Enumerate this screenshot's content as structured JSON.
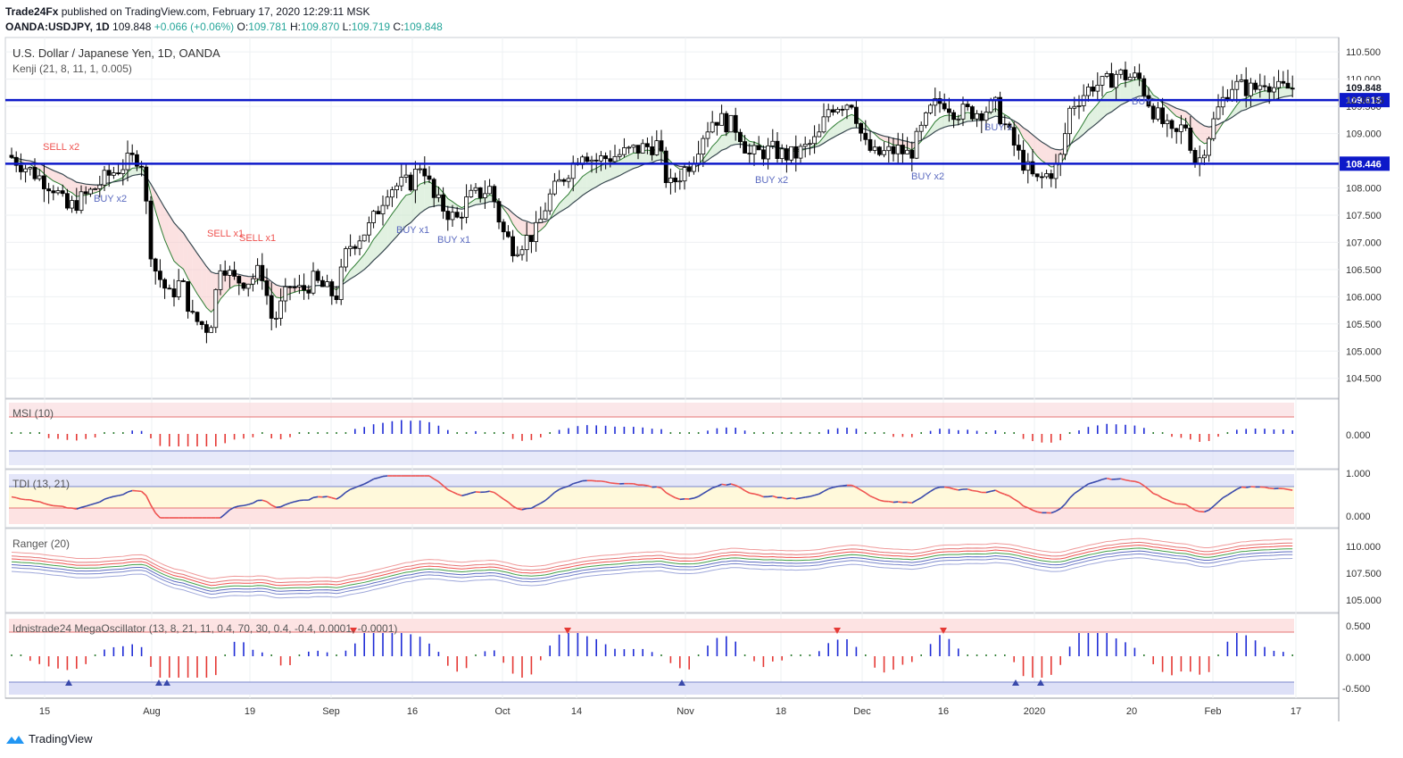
{
  "header": {
    "publisher": "Trade24Fx",
    "published_text": "published on TradingView.com, February 17, 2020 12:29:11 MSK",
    "symbol": "OANDA:USDJPY, 1D",
    "last": "109.848",
    "change": "+0.066 (+0.06%)",
    "o_label": "O:",
    "o": "109.781",
    "h_label": "H:",
    "h": "109.870",
    "l_label": "L:",
    "l": "109.719",
    "c_label": "C:",
    "c": "109.848"
  },
  "main_pane": {
    "title": "U.S. Dollar / Japanese Yen, 1D, OANDA",
    "indicator": "Kenji (21, 8, 11, 1, 0.005)",
    "price_labels": {
      "last": "109.848",
      "time": "12:30:56",
      "upper_line": "109.615",
      "lower_line": "108.446"
    }
  },
  "panes": {
    "msi": {
      "label": "MSI (10)",
      "ticks": [
        "0.000"
      ]
    },
    "tdi": {
      "label": "TDI (13, 21)",
      "ticks": [
        "1.000",
        "0.000"
      ]
    },
    "ranger": {
      "label": "Ranger (20)",
      "ticks": [
        "110.000",
        "107.500",
        "105.000"
      ]
    },
    "mega": {
      "label": "Idnistrade24 MegaOscillator (13, 8, 21, 11, 0.4, 70, 30, 0.4, -0.4, 0.0001, -0.0001)",
      "ticks": [
        "0.500",
        "0.000",
        "-0.500"
      ]
    }
  },
  "signals": [
    {
      "text": "SELL x2",
      "type": "sell"
    },
    {
      "text": "BUY x2",
      "type": "buy"
    },
    {
      "text": "SELL x1",
      "type": "sell"
    },
    {
      "text": "SELL x1",
      "type": "sell"
    },
    {
      "text": "BUY x1",
      "type": "buy"
    },
    {
      "text": "BUY x1",
      "type": "buy"
    },
    {
      "text": "BUY x2",
      "type": "buy"
    },
    {
      "text": "BUY x2",
      "type": "buy"
    },
    {
      "text": "BUY x",
      "type": "buy"
    },
    {
      "text": "BUY",
      "type": "buy"
    }
  ],
  "footer": {
    "brand": "TradingView"
  },
  "chart_data": {
    "type": "candlestick",
    "title": "U.S. Dollar / Japanese Yen, 1D, OANDA",
    "y_ticks": [
      "110.500",
      "110.000",
      "109.500",
      "109.000",
      "108.500",
      "108.000",
      "107.500",
      "107.000",
      "106.500",
      "106.000",
      "105.500",
      "105.000",
      "104.500"
    ],
    "ylim": [
      104.2,
      110.7
    ],
    "x_ticks": [
      "15",
      "Aug",
      "19",
      "Sep",
      "16",
      "Oct",
      "14",
      "Nov",
      "18",
      "Dec",
      "16",
      "2020",
      "20",
      "Feb",
      "17"
    ],
    "horizontal_levels": [
      109.615,
      108.446
    ],
    "price_path": [
      [
        "2019-07-08",
        108.6
      ],
      [
        "2019-07-12",
        108.3
      ],
      [
        "2019-07-16",
        108.0
      ],
      [
        "2019-07-18",
        107.6
      ],
      [
        "2019-07-22",
        107.9
      ],
      [
        "2019-07-25",
        108.2
      ],
      [
        "2019-07-29",
        108.5
      ],
      [
        "2019-07-31",
        108.6
      ],
      [
        "2019-08-02",
        106.6
      ],
      [
        "2019-08-05",
        106.0
      ],
      [
        "2019-08-07",
        106.3
      ],
      [
        "2019-08-09",
        105.6
      ],
      [
        "2019-08-12",
        105.4
      ],
      [
        "2019-08-14",
        106.7
      ],
      [
        "2019-08-16",
        106.3
      ],
      [
        "2019-08-19",
        106.3
      ],
      [
        "2019-08-21",
        106.5
      ],
      [
        "2019-08-23",
        105.5
      ],
      [
        "2019-08-26",
        106.2
      ],
      [
        "2019-08-28",
        106.1
      ],
      [
        "2019-08-30",
        106.3
      ],
      [
        "2019-09-03",
        106.0
      ],
      [
        "2019-09-05",
        106.9
      ],
      [
        "2019-09-09",
        107.3
      ],
      [
        "2019-09-12",
        108.0
      ],
      [
        "2019-09-16",
        108.1
      ],
      [
        "2019-09-18",
        108.5
      ],
      [
        "2019-09-20",
        107.8
      ],
      [
        "2019-09-24",
        107.4
      ],
      [
        "2019-09-26",
        107.8
      ],
      [
        "2019-09-30",
        108.0
      ],
      [
        "2019-10-02",
        107.2
      ],
      [
        "2019-10-04",
        106.9
      ],
      [
        "2019-10-08",
        107.2
      ],
      [
        "2019-10-10",
        107.8
      ],
      [
        "2019-10-14",
        108.4
      ],
      [
        "2019-10-16",
        108.7
      ],
      [
        "2019-10-18",
        108.5
      ],
      [
        "2019-10-22",
        108.6
      ],
      [
        "2019-10-25",
        108.7
      ],
      [
        "2019-10-29",
        108.8
      ],
      [
        "2019-10-31",
        108.0
      ],
      [
        "2019-11-04",
        108.5
      ],
      [
        "2019-11-06",
        109.0
      ],
      [
        "2019-11-08",
        109.3
      ],
      [
        "2019-11-12",
        109.1
      ],
      [
        "2019-11-14",
        108.6
      ],
      [
        "2019-11-18",
        108.7
      ],
      [
        "2019-11-20",
        108.6
      ],
      [
        "2019-11-22",
        108.6
      ],
      [
        "2019-11-26",
        108.9
      ],
      [
        "2019-11-28",
        109.5
      ],
      [
        "2019-12-02",
        109.6
      ],
      [
        "2019-12-04",
        108.8
      ],
      [
        "2019-12-06",
        108.6
      ],
      [
        "2019-12-10",
        108.7
      ],
      [
        "2019-12-12",
        108.6
      ],
      [
        "2019-12-16",
        109.5
      ],
      [
        "2019-12-18",
        109.6
      ],
      [
        "2019-12-20",
        109.4
      ],
      [
        "2019-12-24",
        109.4
      ],
      [
        "2019-12-27",
        109.5
      ],
      [
        "2019-12-31",
        108.6
      ],
      [
        "2020-01-03",
        108.1
      ],
      [
        "2020-01-07",
        108.4
      ],
      [
        "2020-01-09",
        109.5
      ],
      [
        "2020-01-13",
        109.9
      ],
      [
        "2020-01-15",
        109.9
      ],
      [
        "2020-01-17",
        110.1
      ],
      [
        "2020-01-21",
        110.0
      ],
      [
        "2020-01-23",
        109.5
      ],
      [
        "2020-01-27",
        108.9
      ],
      [
        "2020-01-29",
        109.2
      ],
      [
        "2020-01-31",
        108.4
      ],
      [
        "2020-02-04",
        109.5
      ],
      [
        "2020-02-06",
        109.9
      ],
      [
        "2020-02-10",
        109.8
      ],
      [
        "2020-02-12",
        110.0
      ],
      [
        "2020-02-14",
        109.8
      ],
      [
        "2020-02-17",
        109.848
      ]
    ]
  }
}
